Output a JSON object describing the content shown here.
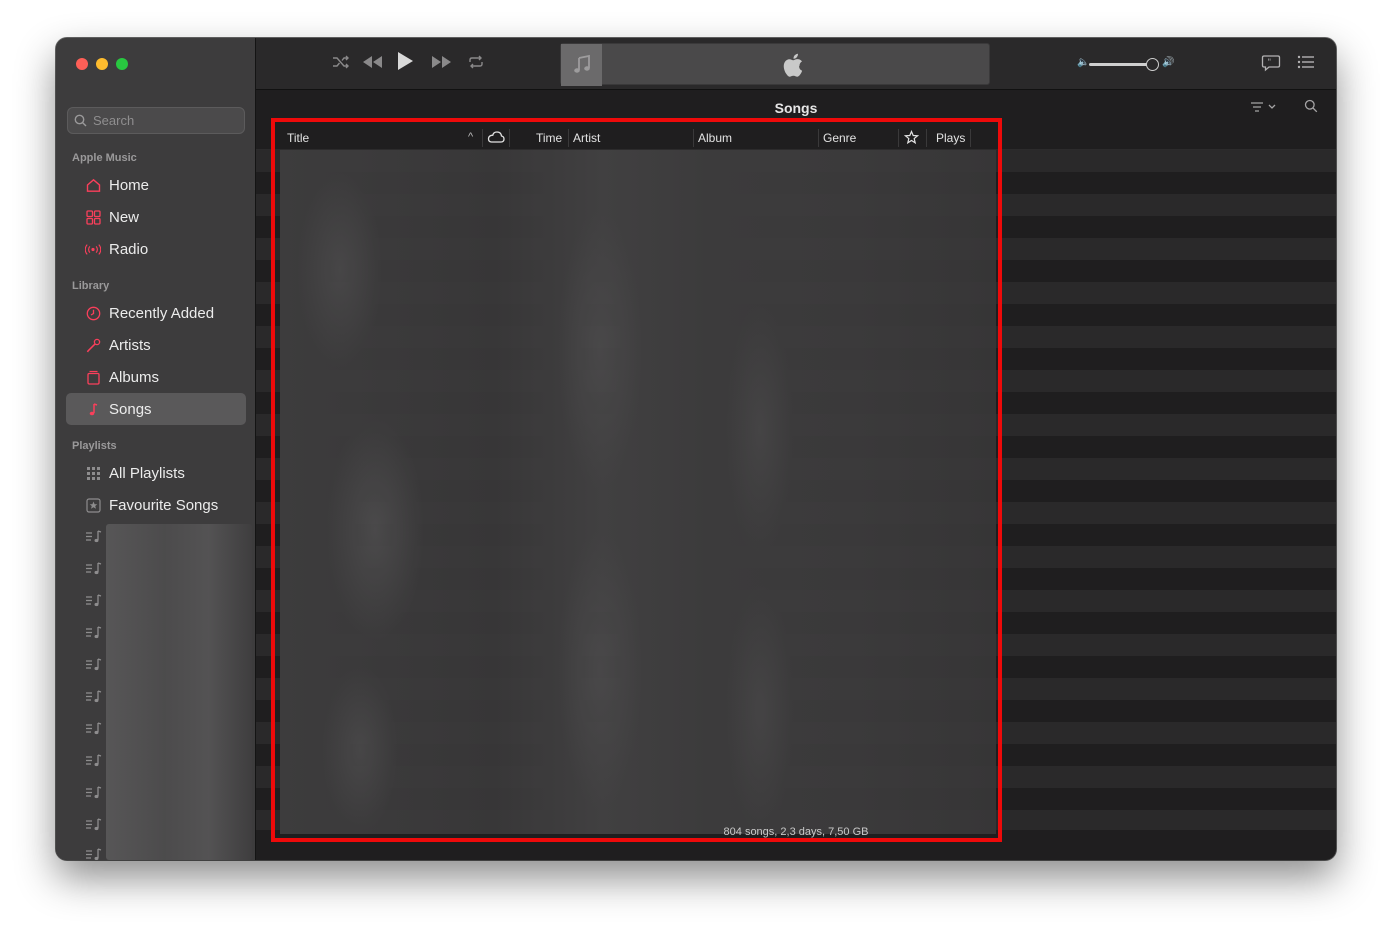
{
  "sidebar": {
    "search_placeholder": "Search",
    "apple_music_label": "Apple Music",
    "apple_music_items": [
      {
        "label": "Home",
        "icon": "home-icon"
      },
      {
        "label": "New",
        "icon": "grid-icon"
      },
      {
        "label": "Radio",
        "icon": "radio-icon"
      }
    ],
    "library_label": "Library",
    "library_items": [
      {
        "label": "Recently Added",
        "icon": "clock-icon"
      },
      {
        "label": "Artists",
        "icon": "microphone-icon"
      },
      {
        "label": "Albums",
        "icon": "album-icon"
      },
      {
        "label": "Songs",
        "icon": "music-note-icon",
        "selected": true
      }
    ],
    "playlists_label": "Playlists",
    "playlist_items": [
      {
        "label": "All Playlists",
        "icon": "grid-icon"
      },
      {
        "label": "Favourite Songs",
        "icon": "star-icon"
      }
    ]
  },
  "content": {
    "title": "Songs",
    "columns": [
      "Title",
      "Time",
      "Artist",
      "Album",
      "Genre",
      "Plays"
    ],
    "footer": "804 songs, 2,3 days, 7,50 GB"
  },
  "colors": {
    "accent": "#fa3f5b",
    "highlight_border": "#ee0a0a"
  }
}
